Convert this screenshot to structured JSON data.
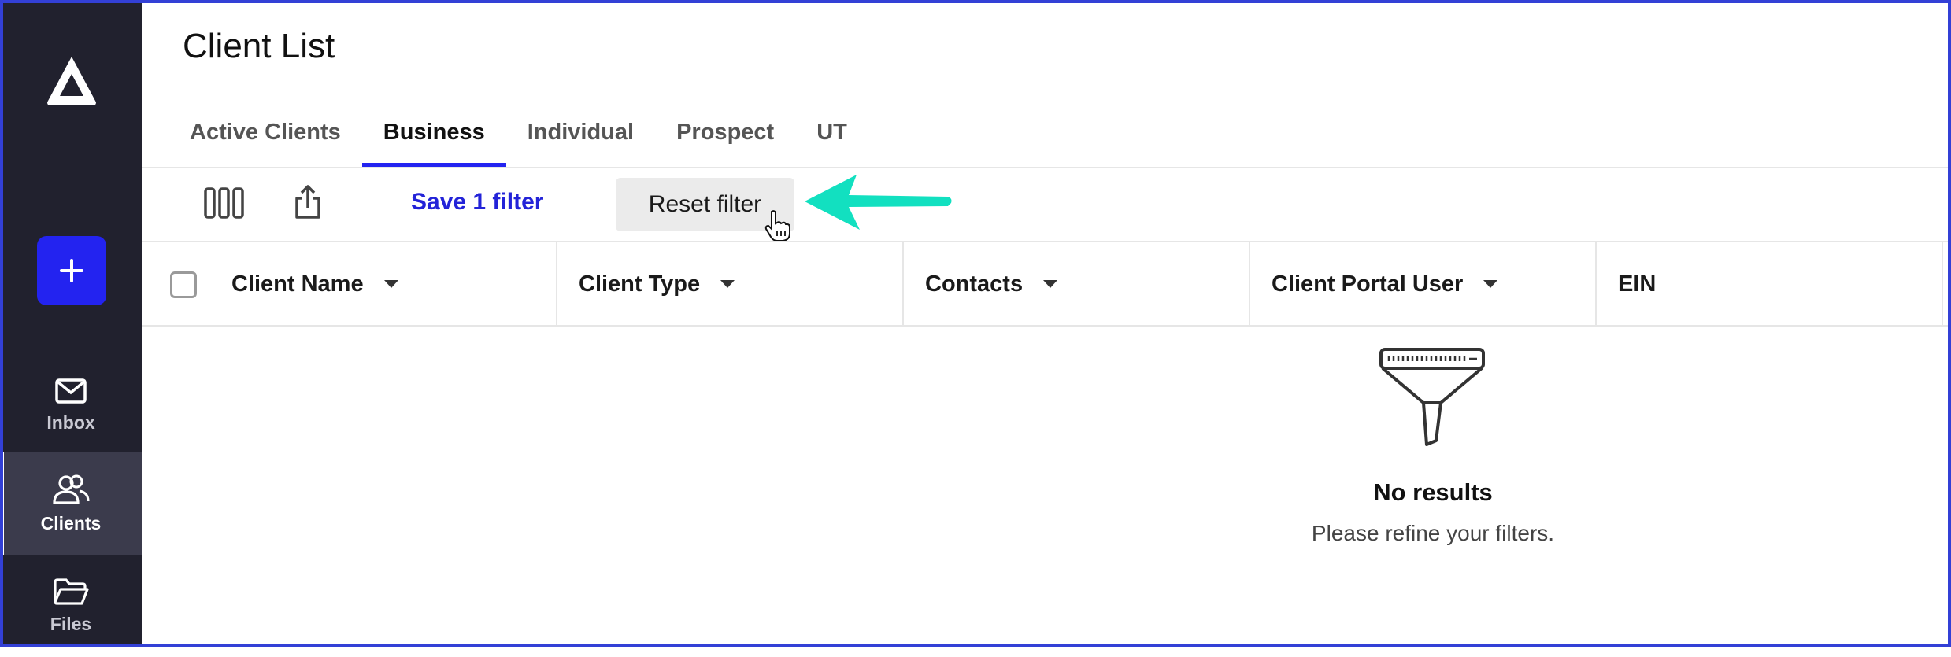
{
  "sidebar": {
    "items": [
      {
        "label": "Inbox",
        "icon": "mail-icon"
      },
      {
        "label": "Clients",
        "icon": "users-icon"
      },
      {
        "label": "Files",
        "icon": "folder-icon"
      }
    ],
    "new_button_symbol": "+",
    "accent": "#2323f0",
    "background": "#21212e"
  },
  "header": {
    "title": "Client List"
  },
  "tabs": [
    {
      "label": "Active Clients"
    },
    {
      "label": "Business"
    },
    {
      "label": "Individual"
    },
    {
      "label": "Prospect"
    },
    {
      "label": "UT"
    }
  ],
  "active_tab": "Business",
  "toolbar": {
    "save_filter_label": "Save 1 filter",
    "reset_filter_label": "Reset filter"
  },
  "table": {
    "columns": [
      {
        "label": "Client Name",
        "sortable": true
      },
      {
        "label": "Client Type",
        "sortable": true
      },
      {
        "label": "Contacts",
        "sortable": true
      },
      {
        "label": "Client Portal User",
        "sortable": true
      },
      {
        "label": "EIN",
        "sortable": false
      }
    ]
  },
  "empty_state": {
    "title": "No results",
    "subtitle": "Please refine your filters."
  },
  "annotation": {
    "arrow_color": "#12e0c0"
  }
}
